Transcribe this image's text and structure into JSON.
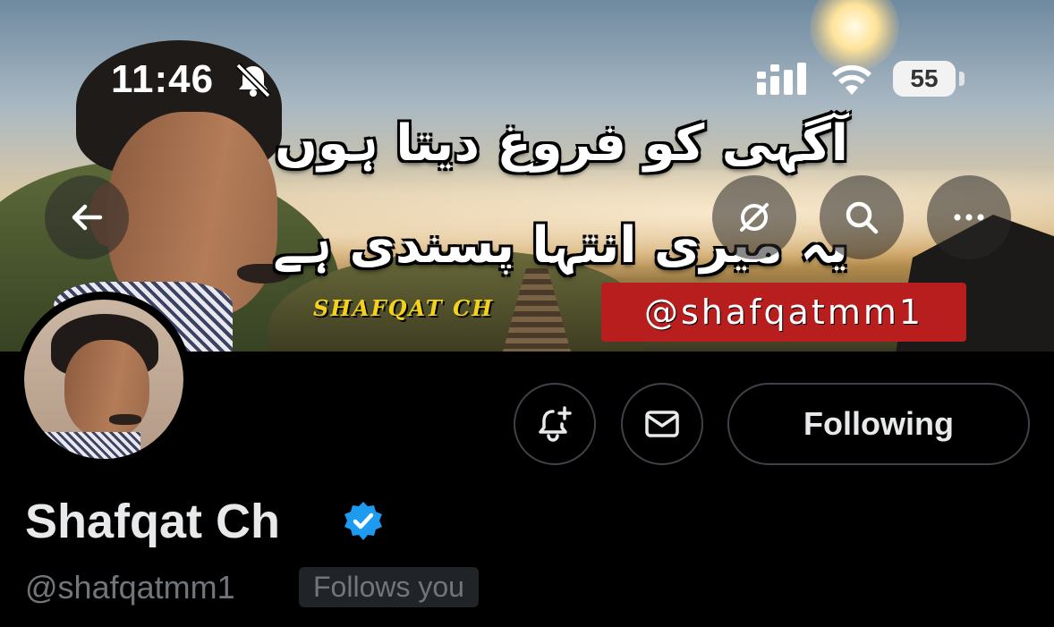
{
  "status_bar": {
    "time": "11:46",
    "icons": [
      "bell-slash-icon",
      "cellular-signal-icon",
      "wifi-icon"
    ],
    "battery_level": "55"
  },
  "banner": {
    "urdu_line_1": "آگہی کو فروغ دیتا ہوں",
    "urdu_line_2": "یہ میری انتہا پسندی ہے",
    "signature": "SHAFQAT CH",
    "handle_tag": "@shafqatmm1"
  },
  "header_buttons": [
    "back-arrow-icon",
    "grok-icon",
    "search-icon",
    "more-icon"
  ],
  "actions": {
    "notify_icon": "bell-plus-icon",
    "message_icon": "envelope-icon",
    "following_label": "Following"
  },
  "profile": {
    "display_name": "Shafqat Ch",
    "verified": true,
    "verified_color": "#1d9bf0",
    "handle": "@shafqatmm1",
    "follows_you_label": "Follows you"
  },
  "colors": {
    "background": "#000000",
    "primary_text": "#e7e9ea",
    "secondary_text": "#71767b",
    "button_border": "#3e4349",
    "handle_tag_bg": "#b81e1e",
    "signature_color": "#f5d21a"
  }
}
